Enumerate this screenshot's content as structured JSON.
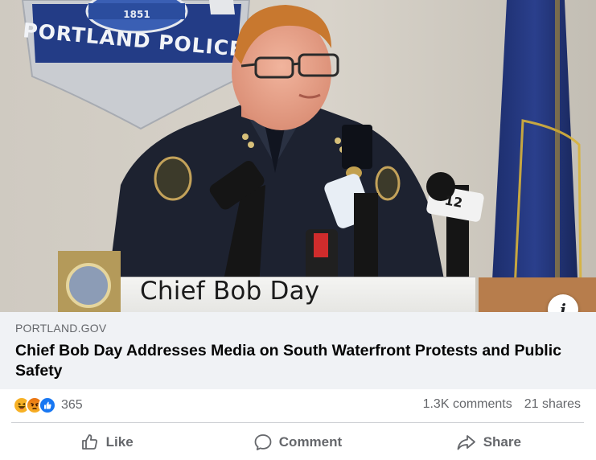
{
  "media": {
    "badge_text": "PORTLAND POLICE",
    "badge_year": "1851",
    "mic_logo": "12",
    "caption": "Chief Bob Day",
    "info_label": "i"
  },
  "link": {
    "domain": "PORTLAND.GOV",
    "headline": "Chief Bob Day Addresses Media on South Waterfront Protests and Public Safety"
  },
  "reactions": {
    "icons": [
      "haha-icon",
      "angry-icon",
      "like-icon"
    ],
    "count": "365"
  },
  "stats": {
    "comments": "1.3K comments",
    "shares": "21 shares"
  },
  "actions": {
    "like": "Like",
    "comment": "Comment",
    "share": "Share"
  },
  "colors": {
    "link_bg": "#f0f2f5",
    "secondary_text": "#65676b",
    "like_blue": "#1877f2",
    "angry_orange": "#e9710f",
    "haha_yellow": "#f7b125"
  }
}
